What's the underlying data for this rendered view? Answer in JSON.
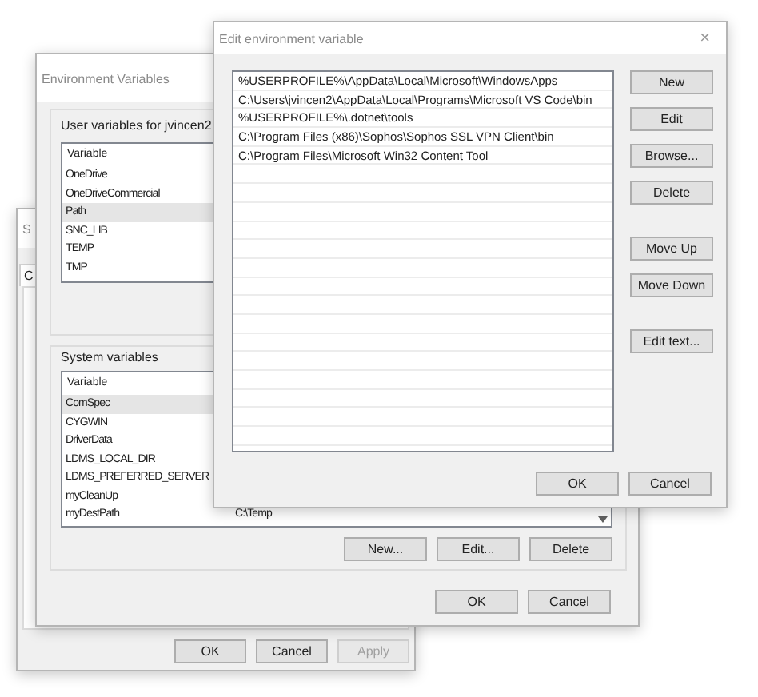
{
  "system_properties": {
    "title": "S",
    "tab": "C",
    "buttons": [
      {
        "label": "OK",
        "disabled": false
      },
      {
        "label": "Cancel",
        "disabled": false
      },
      {
        "label": "Apply",
        "disabled": true
      }
    ]
  },
  "environment_variables": {
    "title": "Environment Variables",
    "user_section": {
      "label": "User variables for jvincen2",
      "columns": [
        "Variable"
      ],
      "rows": [
        {
          "variable": "OneDrive",
          "selected": false
        },
        {
          "variable": "OneDriveCommercial",
          "selected": false
        },
        {
          "variable": "Path",
          "selected": true
        },
        {
          "variable": "SNC_LIB",
          "selected": false
        },
        {
          "variable": "TEMP",
          "selected": false
        },
        {
          "variable": "TMP",
          "selected": false
        }
      ]
    },
    "system_section": {
      "label": "System variables",
      "columns": [
        "Variable"
      ],
      "rows": [
        {
          "variable": "ComSpec",
          "selected": true
        },
        {
          "variable": "CYGWIN",
          "selected": false
        },
        {
          "variable": "DriverData",
          "selected": false
        },
        {
          "variable": "LDMS_LOCAL_DIR",
          "selected": false
        },
        {
          "variable": "LDMS_PREFERRED_SERVER",
          "selected": false
        },
        {
          "variable": "myCleanUp",
          "selected": false
        },
        {
          "variable": "myDestPath",
          "value": "C:\\Temp",
          "selected": false
        }
      ],
      "buttons": [
        "New...",
        "Edit...",
        "Delete"
      ]
    },
    "buttons": [
      "OK",
      "Cancel"
    ]
  },
  "edit_environment_variable": {
    "title": "Edit environment variable",
    "close": "×",
    "entries": [
      {
        "text": "%USERPROFILE%\\AppData\\Local\\Microsoft\\WindowsApps",
        "selected": false
      },
      {
        "text": "C:\\Users\\jvincen2\\AppData\\Local\\Programs\\Microsoft VS Code\\bin",
        "selected": false
      },
      {
        "text": "%USERPROFILE%\\.dotnet\\tools",
        "selected": false
      },
      {
        "text": "C:\\Program Files (x86)\\Sophos\\Sophos SSL VPN Client\\bin",
        "selected": false
      },
      {
        "text": "C:\\Program Files\\Microsoft Win32 Content Tool",
        "selected": false
      }
    ],
    "side_button_groups": [
      [
        "New",
        "Edit",
        "Browse...",
        "Delete"
      ],
      [
        "Move Up",
        "Move Down"
      ],
      [
        "Edit text..."
      ]
    ],
    "buttons": [
      "OK",
      "Cancel"
    ]
  }
}
